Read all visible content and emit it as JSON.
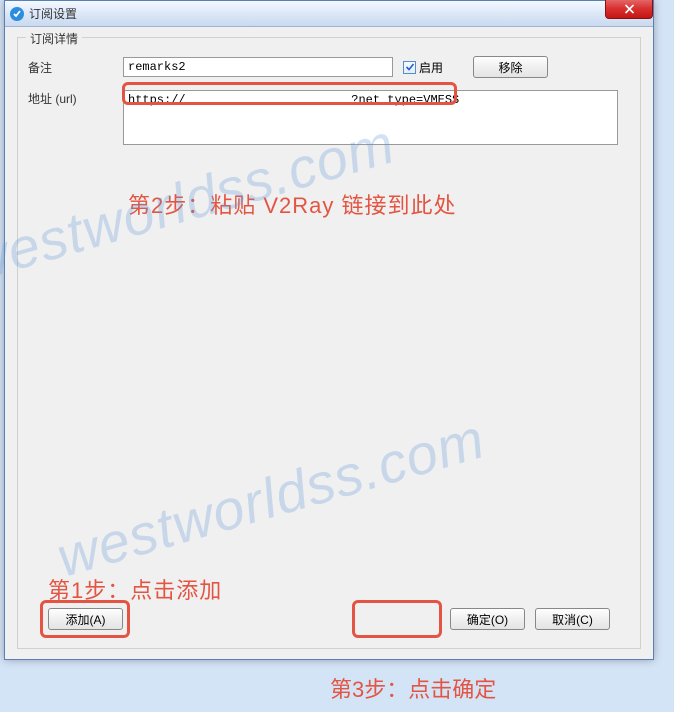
{
  "window": {
    "title": "订阅设置"
  },
  "fieldset": {
    "legend": "订阅详情"
  },
  "form": {
    "remarks_label": "备注",
    "remarks_value": "remarks2",
    "enable_label": "启用",
    "remove_label": "移除",
    "url_label": "地址 (url)",
    "url_value": "https://                       ?net_type=VMESS"
  },
  "buttons": {
    "add": "添加(A)",
    "ok": "确定(O)",
    "cancel": "取消(C)"
  },
  "annotations": {
    "step1": "第1步：点击添加",
    "step2": "第2步：粘贴 V2Ray 链接到此处",
    "step3": "第3步：点击确定"
  },
  "watermark": "westworldss.com"
}
